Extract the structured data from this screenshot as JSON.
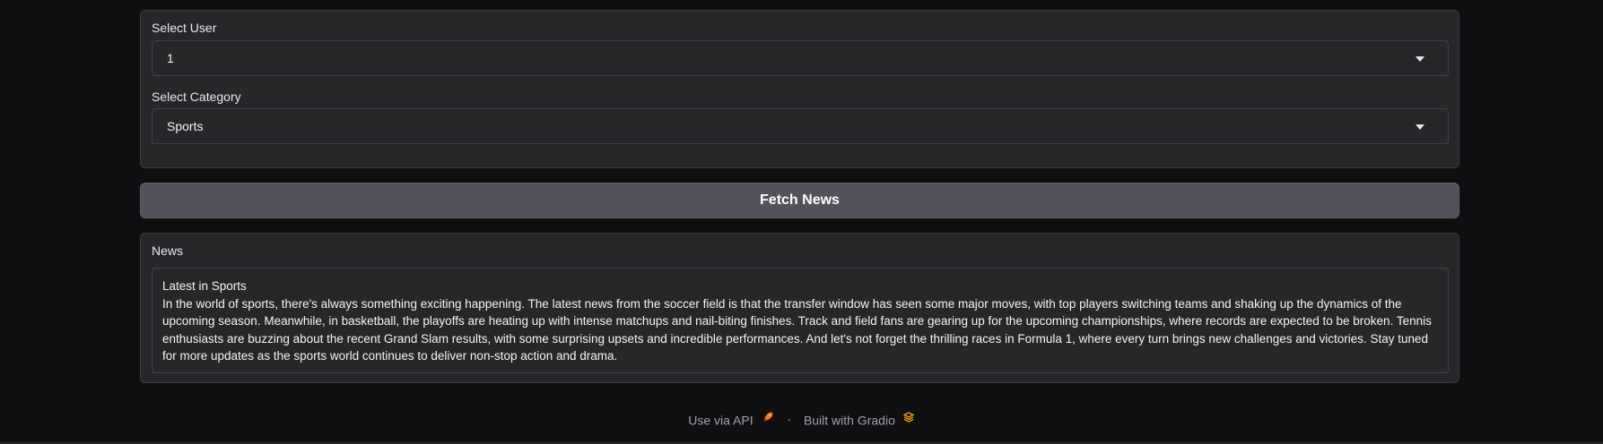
{
  "inputs": {
    "user_label": "Select User",
    "user_value": "1",
    "category_label": "Select Category",
    "category_value": "Sports"
  },
  "fetch_button": "Fetch News",
  "news": {
    "label": "News",
    "content": "Latest in Sports\nIn the world of sports, there's always something exciting happening. The latest news from the soccer field is that the transfer window has seen some major moves, with top players switching teams and shaking up the dynamics of the upcoming season. Meanwhile, in basketball, the playoffs are heating up with intense matchups and nail-biting finishes. Track and field fans are gearing up for the upcoming championships, where records are expected to be broken. Tennis enthusiasts are buzzing about the recent Grand Slam results, with some surprising upsets and incredible performances. And let's not forget the thrilling races in Formula 1, where every turn brings new challenges and victories. Stay tuned for more updates as the sports world continues to deliver non-stop action and drama."
  },
  "footer": {
    "api_link": "Use via API",
    "separator": "·",
    "built_with": "Built with Gradio",
    "api_icon": "rocket-icon",
    "gradio_icon": "gradio-logo-icon"
  }
}
